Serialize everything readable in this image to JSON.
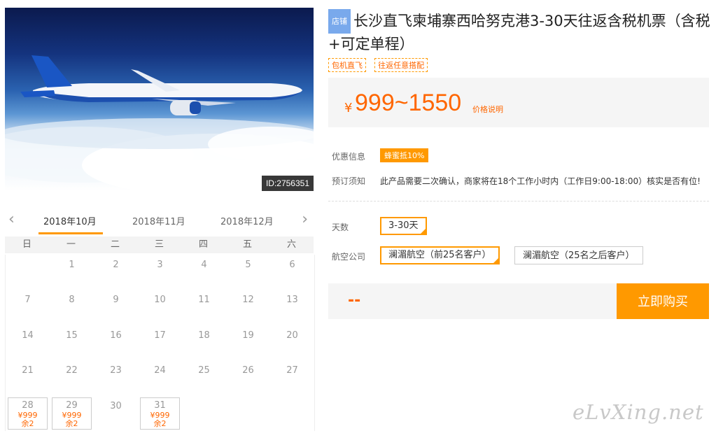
{
  "photo": {
    "id_label": "ID:2756351"
  },
  "calendar": {
    "months": [
      "2018年10月",
      "2018年11月",
      "2018年12月"
    ],
    "active_month": 0,
    "weekdays": [
      "日",
      "一",
      "二",
      "三",
      "四",
      "五",
      "六"
    ],
    "days": [
      {
        "d": ""
      },
      {
        "d": "1"
      },
      {
        "d": "2"
      },
      {
        "d": "3"
      },
      {
        "d": "4"
      },
      {
        "d": "5"
      },
      {
        "d": "6"
      },
      {
        "d": "7"
      },
      {
        "d": "8"
      },
      {
        "d": "9"
      },
      {
        "d": "10"
      },
      {
        "d": "11"
      },
      {
        "d": "12"
      },
      {
        "d": "13"
      },
      {
        "d": "14"
      },
      {
        "d": "15"
      },
      {
        "d": "16"
      },
      {
        "d": "17"
      },
      {
        "d": "18"
      },
      {
        "d": "19"
      },
      {
        "d": "20"
      },
      {
        "d": "21"
      },
      {
        "d": "22"
      },
      {
        "d": "23"
      },
      {
        "d": "24"
      },
      {
        "d": "25"
      },
      {
        "d": "26"
      },
      {
        "d": "27"
      },
      {
        "d": "28",
        "price": "¥999",
        "left": "余2"
      },
      {
        "d": "29",
        "price": "¥999",
        "left": "余2"
      },
      {
        "d": "30"
      },
      {
        "d": "31",
        "price": "¥999",
        "left": "余2"
      }
    ]
  },
  "product": {
    "shop_badge": "店铺",
    "title": "长沙直飞柬埔寨西哈努克港3-30天往返含税机票（含税+可定单程）",
    "tags": [
      "包机直飞",
      "往返任意搭配"
    ],
    "price": {
      "currency": "¥",
      "range": "999~1550",
      "note": "价格说明"
    },
    "promo": {
      "label": "优惠信息",
      "badge": "蜂蜜抵10%"
    },
    "notice": {
      "label": "预订须知",
      "text": "此产品需要二次确认，商家将在18个工作小时内（工作日9:00-18:00）核实是否有位!"
    },
    "days": {
      "label": "天数",
      "options": [
        "3-30天"
      ],
      "selected": 0
    },
    "airline": {
      "label": "航空公司",
      "options": [
        "澜湄航空（前25名客户）",
        "澜湄航空（25名之后客户）"
      ],
      "selected": 0
    },
    "total": "--",
    "buy_label": "立即购买"
  },
  "watermark": "eLvXing.net"
}
